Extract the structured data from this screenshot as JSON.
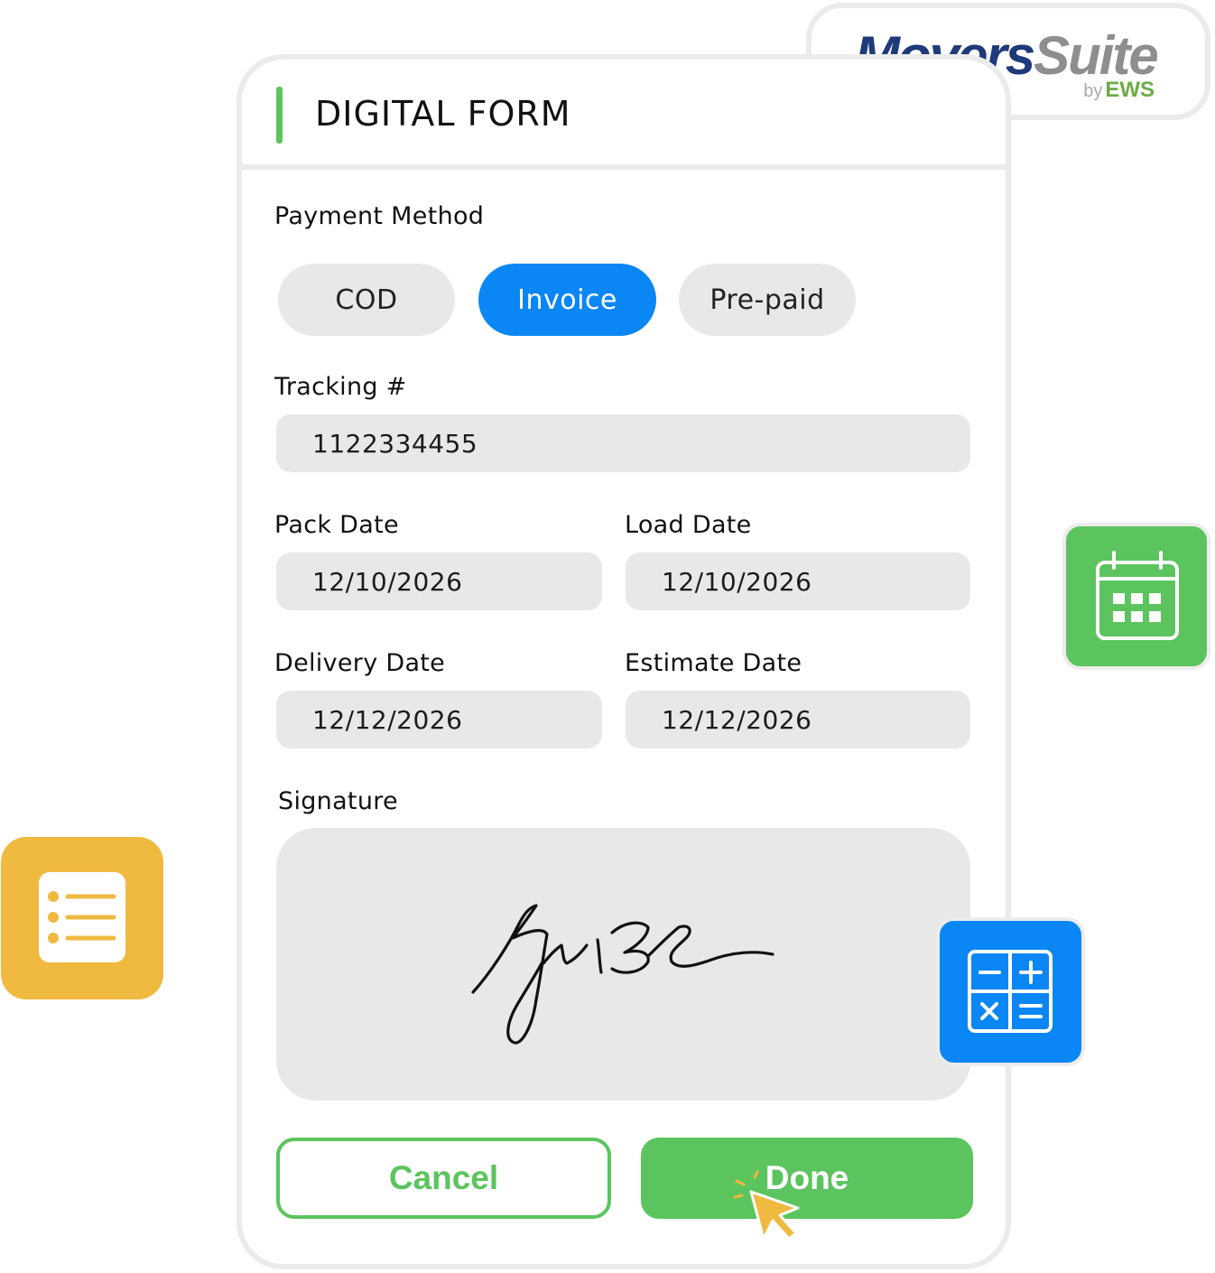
{
  "logo": {
    "brand_primary": "Movers",
    "brand_secondary": "Suite",
    "by_text": "by",
    "company": "EWS"
  },
  "form": {
    "title": "DIGITAL FORM",
    "payment_method": {
      "label": "Payment Method",
      "options": [
        "COD",
        "Invoice",
        "Pre-paid"
      ],
      "selected": "Invoice"
    },
    "tracking": {
      "label": "Tracking #",
      "value": "1122334455"
    },
    "pack_date": {
      "label": "Pack Date",
      "value": "12/10/2026"
    },
    "load_date": {
      "label": "Load Date",
      "value": "12/10/2026"
    },
    "delivery_date": {
      "label": "Delivery Date",
      "value": "12/12/2026"
    },
    "estimate_date": {
      "label": "Estimate Date",
      "value": "12/12/2026"
    },
    "signature": {
      "label": "Signature"
    },
    "cancel_label": "Cancel",
    "done_label": "Done"
  },
  "icons": {
    "calendar_tile": "calendar-icon",
    "calculator_tile": "calculator-icon",
    "list_tile": "list-icon",
    "cursor": "cursor-arrow-icon"
  },
  "colors": {
    "accent_green": "#5cc45e",
    "accent_blue": "#0a86f5",
    "accent_yellow": "#f0b940",
    "brand_navy": "#1e3a7b",
    "brand_gray": "#8e8e8e",
    "brand_green": "#6cab47",
    "field_gray": "#e8e8e8"
  }
}
